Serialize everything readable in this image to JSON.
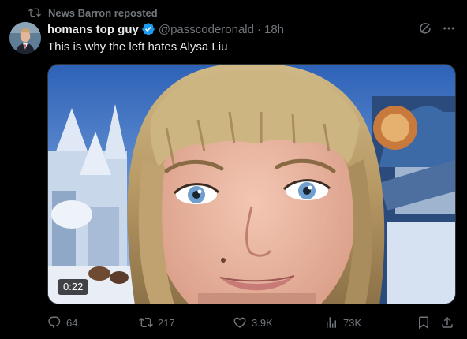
{
  "repost": {
    "label": "News Barron reposted"
  },
  "author": {
    "display_name": "homans top guy",
    "handle": "@passcoderonald",
    "separator": "·",
    "time": "18h",
    "verified_color": "#1d9bf0"
  },
  "post": {
    "text": "This is why the left hates Alysa Liu"
  },
  "media": {
    "duration": "0:22"
  },
  "actions": {
    "replies": "64",
    "reposts": "217",
    "likes": "3.9K",
    "views": "73K"
  },
  "icons": {
    "repost": "repost-icon",
    "verified": "verified-badge-icon",
    "grok": "grok-icon",
    "more": "more-icon",
    "reply": "reply-icon",
    "like": "heart-icon",
    "views": "views-icon",
    "bookmark": "bookmark-icon",
    "share": "share-icon"
  },
  "colors": {
    "background": "#000000",
    "text": "#e7e9ea",
    "muted": "#71767b",
    "border": "#2f3336"
  }
}
